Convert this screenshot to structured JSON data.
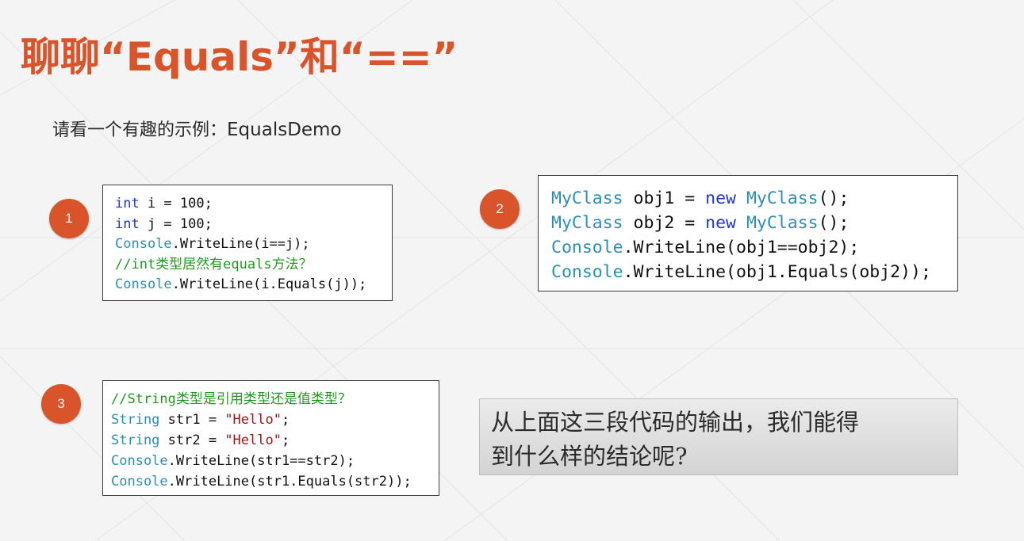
{
  "slide": {
    "title": "聊聊“Equals”和“==”",
    "subtitle_prefix": "请看一个有趣的示例：",
    "subtitle_demo": "EqualsDemo"
  },
  "badges": [
    "1",
    "2",
    "3"
  ],
  "box1": {
    "l1_kw": "int",
    "l1_rest": " i = 100;",
    "l2_kw": "int",
    "l2_rest": " j = 100;",
    "l3_ty": "Console",
    "l3_rest": ".WriteLine(i==j);",
    "l4_comment": "//int类型居然有equals方法？",
    "l5_ty": "Console",
    "l5_rest": ".WriteLine(i.Equals(j));"
  },
  "box2": {
    "l1_ty": "MyClass",
    "l1_mid": " obj1 = ",
    "l1_kw": "new",
    "l1_sp": " ",
    "l1_ty2": "MyClass",
    "l1_end": "();",
    "l2_ty": "MyClass",
    "l2_mid": " obj2 = ",
    "l2_kw": "new",
    "l2_sp": " ",
    "l2_ty2": "MyClass",
    "l2_end": "();",
    "l3_ty": "Console",
    "l3_rest": ".WriteLine(obj1==obj2);",
    "l4_ty": "Console",
    "l4_rest": ".WriteLine(obj1.Equals(obj2));"
  },
  "box3": {
    "l1_comment": "//String类型是引用类型还是值类型？",
    "l2_ty": "String",
    "l2_mid": " str1 = ",
    "l2_str": "\"Hello\"",
    "l2_end": ";",
    "l3_ty": "String",
    "l3_mid": " str2 = ",
    "l3_str": "\"Hello\"",
    "l3_end": ";",
    "l4_ty": "Console",
    "l4_rest": ".WriteLine(str1==str2);",
    "l5_ty": "Console",
    "l5_rest": ".WriteLine(str1.Equals(str2));"
  },
  "question": {
    "line1": "从上面这三段代码的输出，我们能得",
    "line2": "到什么样的结论呢?"
  },
  "colors": {
    "accent": "#d9532b",
    "keyword": "#1f35d8",
    "type": "#2b8fb5",
    "comment": "#1f9a1f",
    "string": "#a31515"
  }
}
